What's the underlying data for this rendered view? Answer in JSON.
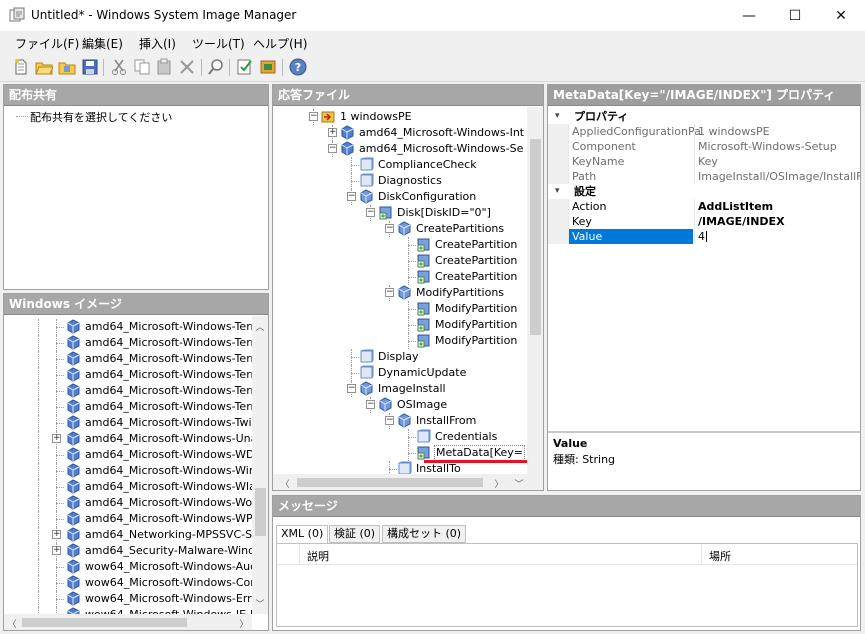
{
  "window": {
    "title": "Untitled* - Windows System Image Manager",
    "minimize": "—",
    "maximize": "☐",
    "close": "✕"
  },
  "menu": [
    "ファイル(F)",
    "編集(E)",
    "挿入(I)",
    "ツール(T)",
    "ヘルプ(H)"
  ],
  "panels": {
    "distribution_share": {
      "title": "配布共有",
      "placeholder": "配布共有を選択してください"
    },
    "windows_image": {
      "title": "Windows イメージ",
      "items": [
        "amd64_Microsoft-Windows-Term",
        "amd64_Microsoft-Windows-Term",
        "amd64_Microsoft-Windows-Term",
        "amd64_Microsoft-Windows-Term",
        "amd64_Microsoft-Windows-Term",
        "amd64_Microsoft-Windows-Term",
        "amd64_Microsoft-Windows-Twin",
        "amd64_Microsoft-Windows-Unat",
        "amd64_Microsoft-Windows-WDF",
        "amd64_Microsoft-Windows-WinR",
        "amd64_Microsoft-Windows-Wlan",
        "amd64_Microsoft-Windows-Work",
        "amd64_Microsoft-Windows-WPD",
        "amd64_Networking-MPSSVC-Sv",
        "amd64_Security-Malware-Windo",
        "wow64_Microsoft-Windows-Audi",
        "wow64_Microsoft-Windows-Core",
        "wow64_Microsoft-Windows-Error",
        "wow64_Microsoft-Windows-IE-I"
      ]
    },
    "answer_file": {
      "title": "応答ファイル",
      "nodes": [
        "1 windowsPE",
        "amd64_Microsoft-Windows-Int",
        "amd64_Microsoft-Windows-Se",
        "ComplianceCheck",
        "Diagnostics",
        "DiskConfiguration",
        "Disk[DiskID=\"0\"]",
        "CreatePartitions",
        "CreatePartition",
        "CreatePartition",
        "CreatePartition",
        "ModifyPartitions",
        "ModifyPartition",
        "ModifyPartition",
        "ModifyPartition",
        "Display",
        "DynamicUpdate",
        "ImageInstall",
        "OSImage",
        "InstallFrom",
        "Credentials",
        "MetaData[Key=",
        "InstallTo"
      ]
    },
    "properties": {
      "title": "MetaData[Key=\"/IMAGE/INDEX\"] プロパティ",
      "section1": "プロパティ",
      "section2": "設定",
      "rows1": [
        {
          "k": "AppliedConfigurationPa",
          "v": "1 windowsPE"
        },
        {
          "k": "Component",
          "v": "Microsoft-Windows-Setup"
        },
        {
          "k": "KeyName",
          "v": "Key"
        },
        {
          "k": "Path",
          "v": "ImageInstall/OSImage/InstallFro"
        }
      ],
      "rows2": [
        {
          "k": "Action",
          "v": "AddListItem"
        },
        {
          "k": "Key",
          "v": "/IMAGE/INDEX"
        },
        {
          "k": "Value",
          "v": "4"
        }
      ],
      "desc_title": "Value",
      "desc_type": "種類: String"
    },
    "messages": {
      "title": "メッセージ",
      "tabs": [
        "XML (0)",
        "検証 (0)",
        "構成セット (0)"
      ],
      "col_desc": "説明",
      "col_loc": "場所"
    }
  },
  "colors": {
    "header": "#a7a7a7",
    "selection": "#0078d7",
    "underline": "#e81123"
  }
}
